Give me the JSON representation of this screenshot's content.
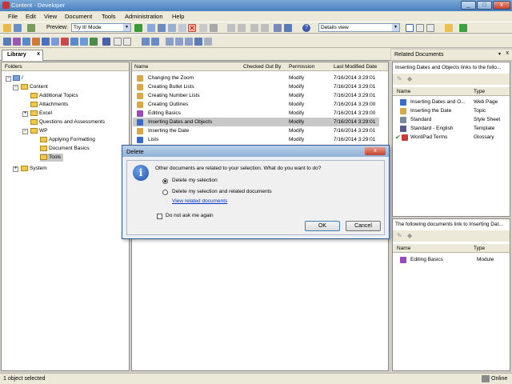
{
  "window": {
    "title": "Content - Developer",
    "min": "_",
    "max": "□",
    "close": "x"
  },
  "menu": [
    "File",
    "Edit",
    "View",
    "Document",
    "Tools",
    "Administration",
    "Help"
  ],
  "toolbar": {
    "preview_label": "Preview:",
    "preview_value": "Try It! Mode",
    "view_value": "Details view"
  },
  "tab": {
    "label": "Library",
    "close": "x"
  },
  "folders": {
    "header": "Folders",
    "items": [
      "/",
      "Content",
      "Additional Topics",
      "Attachments",
      "Excel",
      "Questions and Assessments",
      "WP",
      "Applying Formatting",
      "Document Basics",
      "Tools",
      "System"
    ]
  },
  "doclist": {
    "columns": [
      "Name",
      "Checked Out By",
      "Permission",
      "Last Modified Date"
    ],
    "rows": [
      {
        "name": "Changing the Zoom",
        "permission": "Modify",
        "date": "7/16/2014 3:29:01"
      },
      {
        "name": "Creating Bullet Lists",
        "permission": "Modify",
        "date": "7/16/2014 3:29:01"
      },
      {
        "name": "Creating Number Lists",
        "permission": "Modify",
        "date": "7/16/2014 3:29:01"
      },
      {
        "name": "Creating Outlines",
        "permission": "Modify",
        "date": "7/16/2014 3:29:00"
      },
      {
        "name": "Editing Basics",
        "permission": "Modify",
        "date": "7/16/2014 3:29:00"
      },
      {
        "name": "Inserting Dates and Objects",
        "permission": "Modify",
        "date": "7/16/2014 3:29:01"
      },
      {
        "name": "Inserting the Date",
        "permission": "Modify",
        "date": "7/16/2014 3:29:01"
      },
      {
        "name": "Lists",
        "permission": "Modify",
        "date": "7/16/2014 3:29:01"
      }
    ]
  },
  "related": {
    "title": "Related Documents",
    "description": "Inserting Dates and Objects links to the follo...",
    "columns": [
      "Name",
      "Type"
    ],
    "rows": [
      {
        "name": "Inserting Dates and O...",
        "type": "Web Page"
      },
      {
        "name": "Inserting the Date",
        "type": "Topic"
      },
      {
        "name": "Standard",
        "type": "Style Sheet"
      },
      {
        "name": "Standard - English",
        "type": "Template"
      },
      {
        "name": "WordPad Terms",
        "type": "Glossary"
      }
    ],
    "bottom_description": "The following documents link to Inserting Dat...",
    "bottom_rows": [
      {
        "name": "Editing Basics",
        "type": "Module"
      }
    ]
  },
  "dialog": {
    "title": "Delete",
    "close": "x",
    "message": "Other documents are related to your selection. What do you want to do?",
    "option1": "Delete my selection",
    "option2": "Delete my selection and related documents",
    "link": "View related documents",
    "checkbox": "Do not ask me again",
    "ok": "OK",
    "cancel": "Cancel"
  },
  "status": {
    "left": "1 object selected",
    "right": "Online"
  },
  "colors": {
    "selection": "#c8c8c8",
    "link": "#0033cc",
    "title_gradient_top": "#7aa7d6"
  }
}
